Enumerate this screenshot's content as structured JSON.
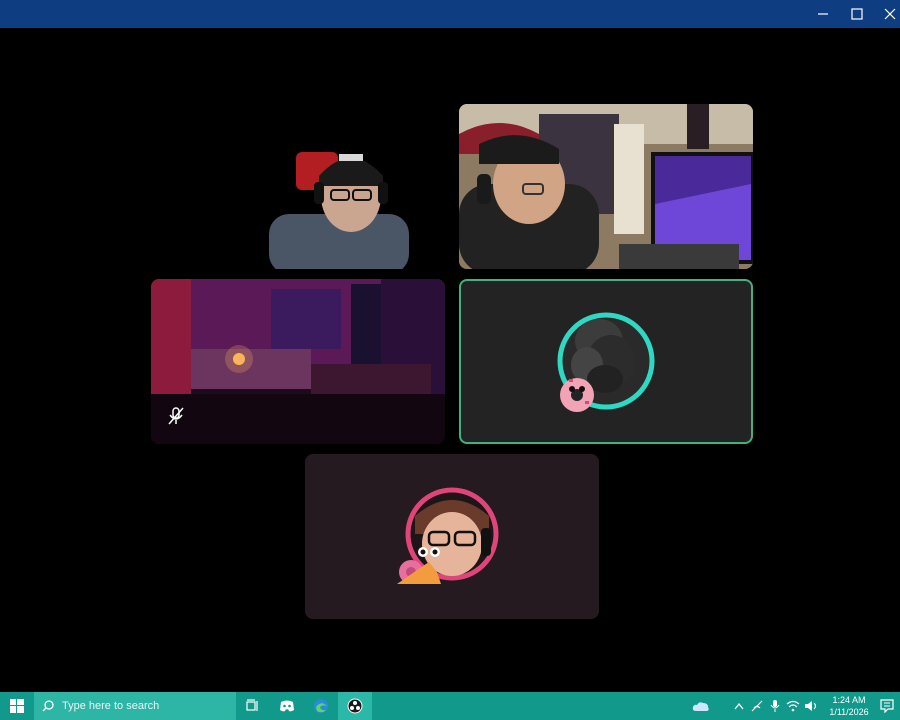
{
  "taskbar": {
    "search_placeholder": "Type here to search",
    "apps": [
      {
        "name": "task-view-icon"
      },
      {
        "name": "discord-icon"
      },
      {
        "name": "edge-icon"
      },
      {
        "name": "obs-icon"
      }
    ],
    "clock": {
      "time": "1:24 AM",
      "date": "1/11/2026"
    }
  },
  "colors": {
    "titlebar": "#0f3d82",
    "taskbar": "#119a8b",
    "speaking_border": "#3fb27f",
    "avatar_ring_teal": "#2fd8c3",
    "avatar_ring_pink": "#e0457a"
  },
  "participants": [
    {
      "tile": "webcam-headset-gamer",
      "video": true
    },
    {
      "tile": "webcam-red-cap",
      "video": true
    },
    {
      "tile": "webcam-purple-room",
      "video": true,
      "muted": true
    },
    {
      "tile": "avatar-donut-smoke",
      "video": false,
      "speaking": true
    },
    {
      "tile": "avatar-snail-glasses",
      "video": false
    }
  ]
}
